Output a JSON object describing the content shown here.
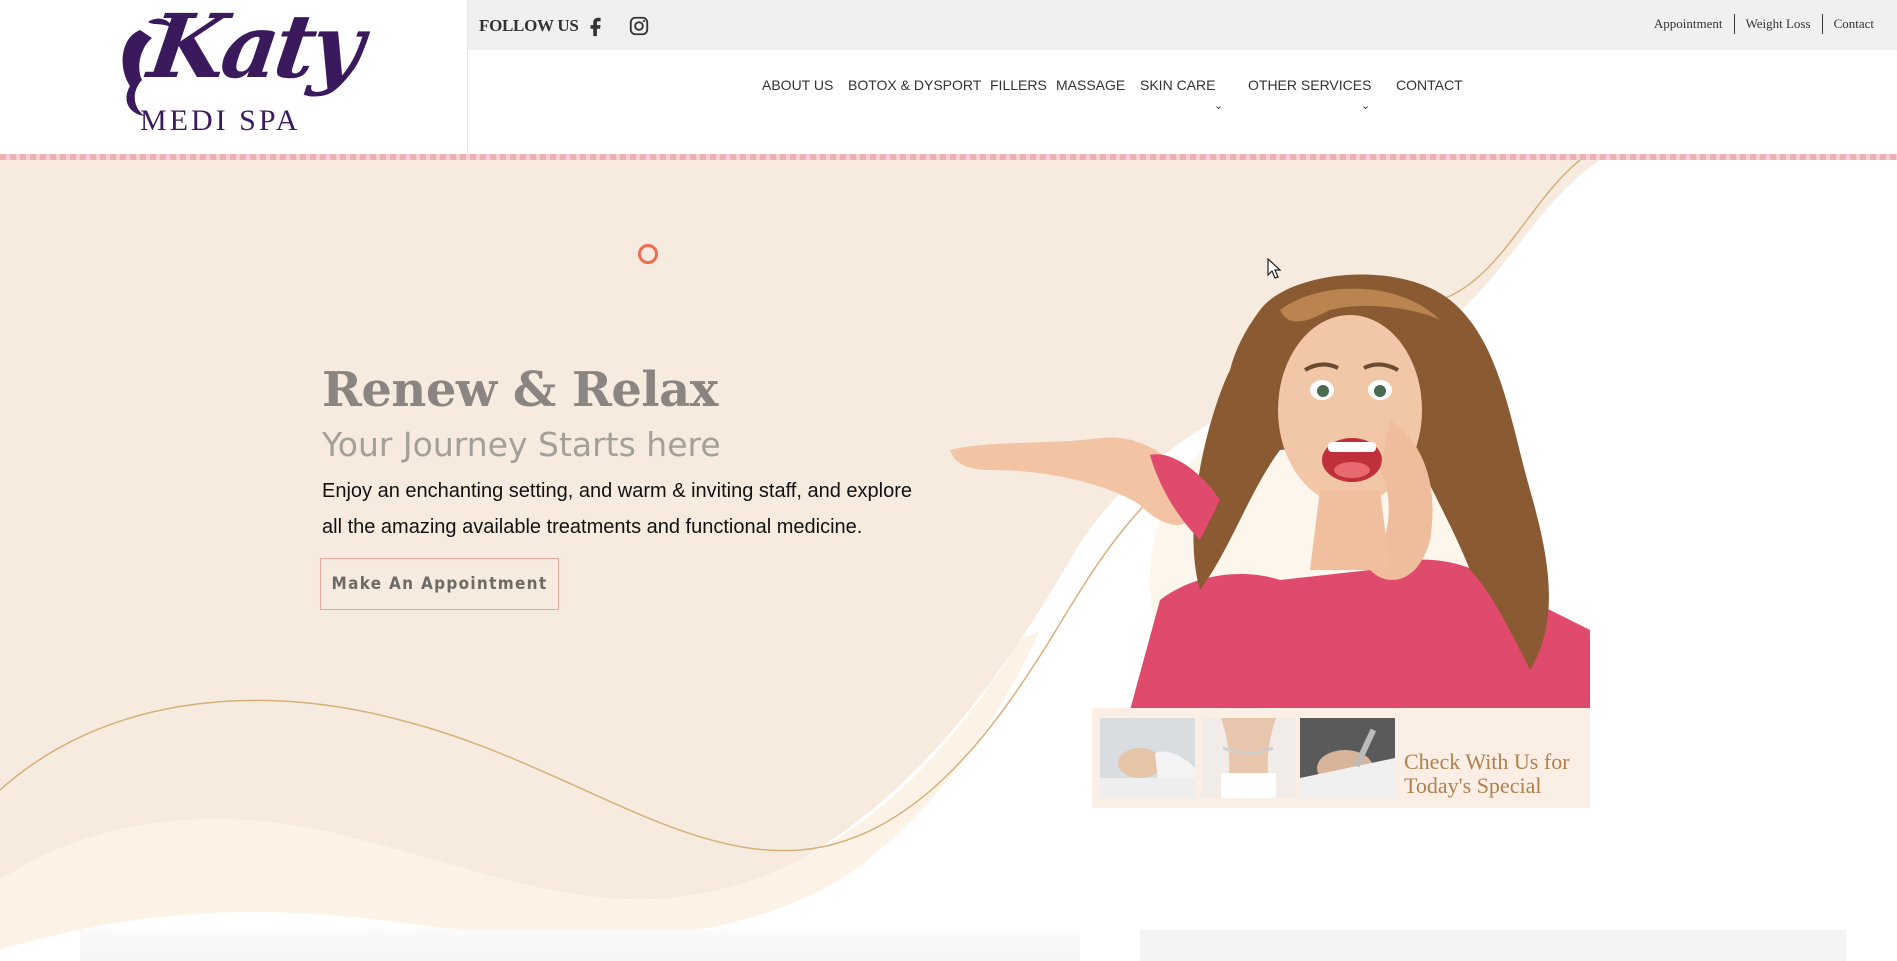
{
  "brand": {
    "logo_script": "Katy",
    "logo_sub": "MEDI SPA"
  },
  "topbar": {
    "follow_label": "FOLLOW US",
    "social": [
      {
        "icon": "facebook-icon"
      },
      {
        "icon": "instagram-icon"
      }
    ],
    "links": [
      "Appointment",
      "Weight Loss",
      "Contact"
    ]
  },
  "nav": {
    "items": [
      {
        "label": "ABOUT US",
        "has_dropdown": false
      },
      {
        "label": "BOTOX & DYSPORT",
        "has_dropdown": false
      },
      {
        "label": "FILLERS",
        "has_dropdown": false
      },
      {
        "label": "MASSAGE",
        "has_dropdown": false
      },
      {
        "label": "SKIN CARE",
        "has_dropdown": true
      },
      {
        "label": "OTHER SERVICES",
        "has_dropdown": true
      },
      {
        "label": "CONTACT",
        "has_dropdown": false
      }
    ]
  },
  "hero": {
    "title": "Renew & Relax",
    "subtitle": "Your Journey Starts here",
    "description": "Enjoy an enchanting setting, and warm & inviting staff, and explore all the amazing available treatments and functional medicine.",
    "cta_label": "Make An Appointment",
    "special_line1": "Check With Us for",
    "special_line2": "Today's Special"
  },
  "colors": {
    "accent_purple": "#3a1a5c",
    "hero_bg": "#f7ebdf",
    "button_border": "#e8a8a0",
    "gold_line": "#d4b07a",
    "loader": "#ef6c50"
  }
}
